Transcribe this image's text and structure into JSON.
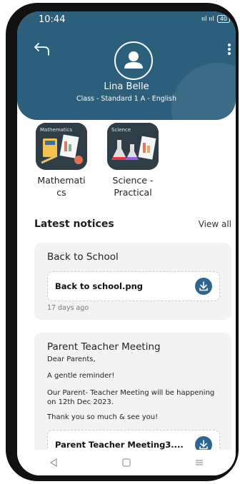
{
  "status": {
    "time": "10:44",
    "signal": "ııl ııl",
    "battery": "40"
  },
  "profile": {
    "name": "Lina Belle",
    "class_line": "Class - Standard 1 A - English"
  },
  "subjects": [
    {
      "thumb_label": "Mathematics",
      "name": "Mathemati\ncs"
    },
    {
      "thumb_label": "Science",
      "name": "Science -\nPractical"
    }
  ],
  "notices": {
    "title": "Latest notices",
    "view_all": "View all",
    "items": [
      {
        "title": "Back to School",
        "attachment": "Back to school.png",
        "time_ago": "17 days ago"
      },
      {
        "title": "Parent Teacher Meeting",
        "body": [
          "Dear Parents,",
          "A gentle reminder!",
          "Our Parent- Teacher Meeting will be happening on 12th Dec 2023.",
          "Thank you so much & see you!"
        ],
        "attachment": "Parent Teacher Meeting3...."
      }
    ]
  },
  "colors": {
    "header": "#2c5f7c",
    "accent": "#2c6593"
  },
  "icons": {
    "back": "back-arrow-icon",
    "menu": "more-vertical-icon",
    "avatar": "user-icon",
    "download": "download-icon",
    "nav": [
      "back-triangle-icon",
      "home-square-icon",
      "recents-icon"
    ]
  }
}
